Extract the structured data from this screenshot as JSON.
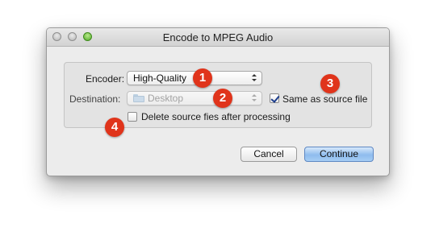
{
  "window": {
    "title": "Encode to MPEG Audio"
  },
  "form": {
    "encoder": {
      "label": "Encoder:",
      "value": "High-Quality",
      "badge": "1"
    },
    "destination": {
      "label": "Destination:",
      "value": "Desktop",
      "icon": "folder-icon",
      "disabled": true,
      "badge": "2"
    },
    "same_as_source": {
      "label": "Same as source file",
      "checked": true,
      "badge": "3"
    },
    "delete_source": {
      "label": "Delete source fies after processing",
      "checked": false,
      "badge": "4"
    }
  },
  "buttons": {
    "cancel": "Cancel",
    "continue": "Continue"
  },
  "colors": {
    "badge": "#e0341b",
    "default_button": "#8fbcee",
    "zoom_button": "#4fa726"
  }
}
